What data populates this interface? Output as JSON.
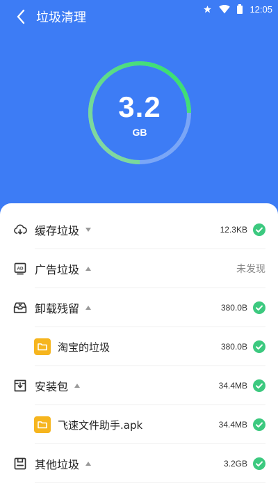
{
  "status": {
    "time": "12:05"
  },
  "header": {
    "title": "垃圾清理"
  },
  "gauge": {
    "value": "3.2",
    "unit": "GB",
    "progress": 0.75
  },
  "colors": {
    "primary": "#3d7cf5",
    "check": "#3cc97f",
    "folder": "#f6b51e",
    "gauge_green": "#37d67a"
  },
  "items": [
    {
      "label": "缓存垃圾",
      "value": "12.3KB",
      "icon": "cloud-cache-icon",
      "expanded": false,
      "status": "checked"
    },
    {
      "label": "广告垃圾",
      "value": "未发现",
      "icon": "ad-icon",
      "expanded": true,
      "status": "none"
    },
    {
      "label": "卸载残留",
      "value": "380.0B",
      "icon": "uninstall-box-icon",
      "expanded": true,
      "status": "checked"
    },
    {
      "label": "淘宝的垃圾",
      "value": "380.0B",
      "icon": "folder-icon",
      "sub": true,
      "status": "checked"
    },
    {
      "label": "安装包",
      "value": "34.4MB",
      "icon": "install-package-icon",
      "expanded": true,
      "status": "checked"
    },
    {
      "label": "飞速文件助手.apk",
      "value": "34.4MB",
      "icon": "folder-icon",
      "sub": true,
      "status": "checked"
    },
    {
      "label": "其他垃圾",
      "value": "3.2GB",
      "icon": "other-trash-icon",
      "expanded": true,
      "status": "checked"
    }
  ]
}
